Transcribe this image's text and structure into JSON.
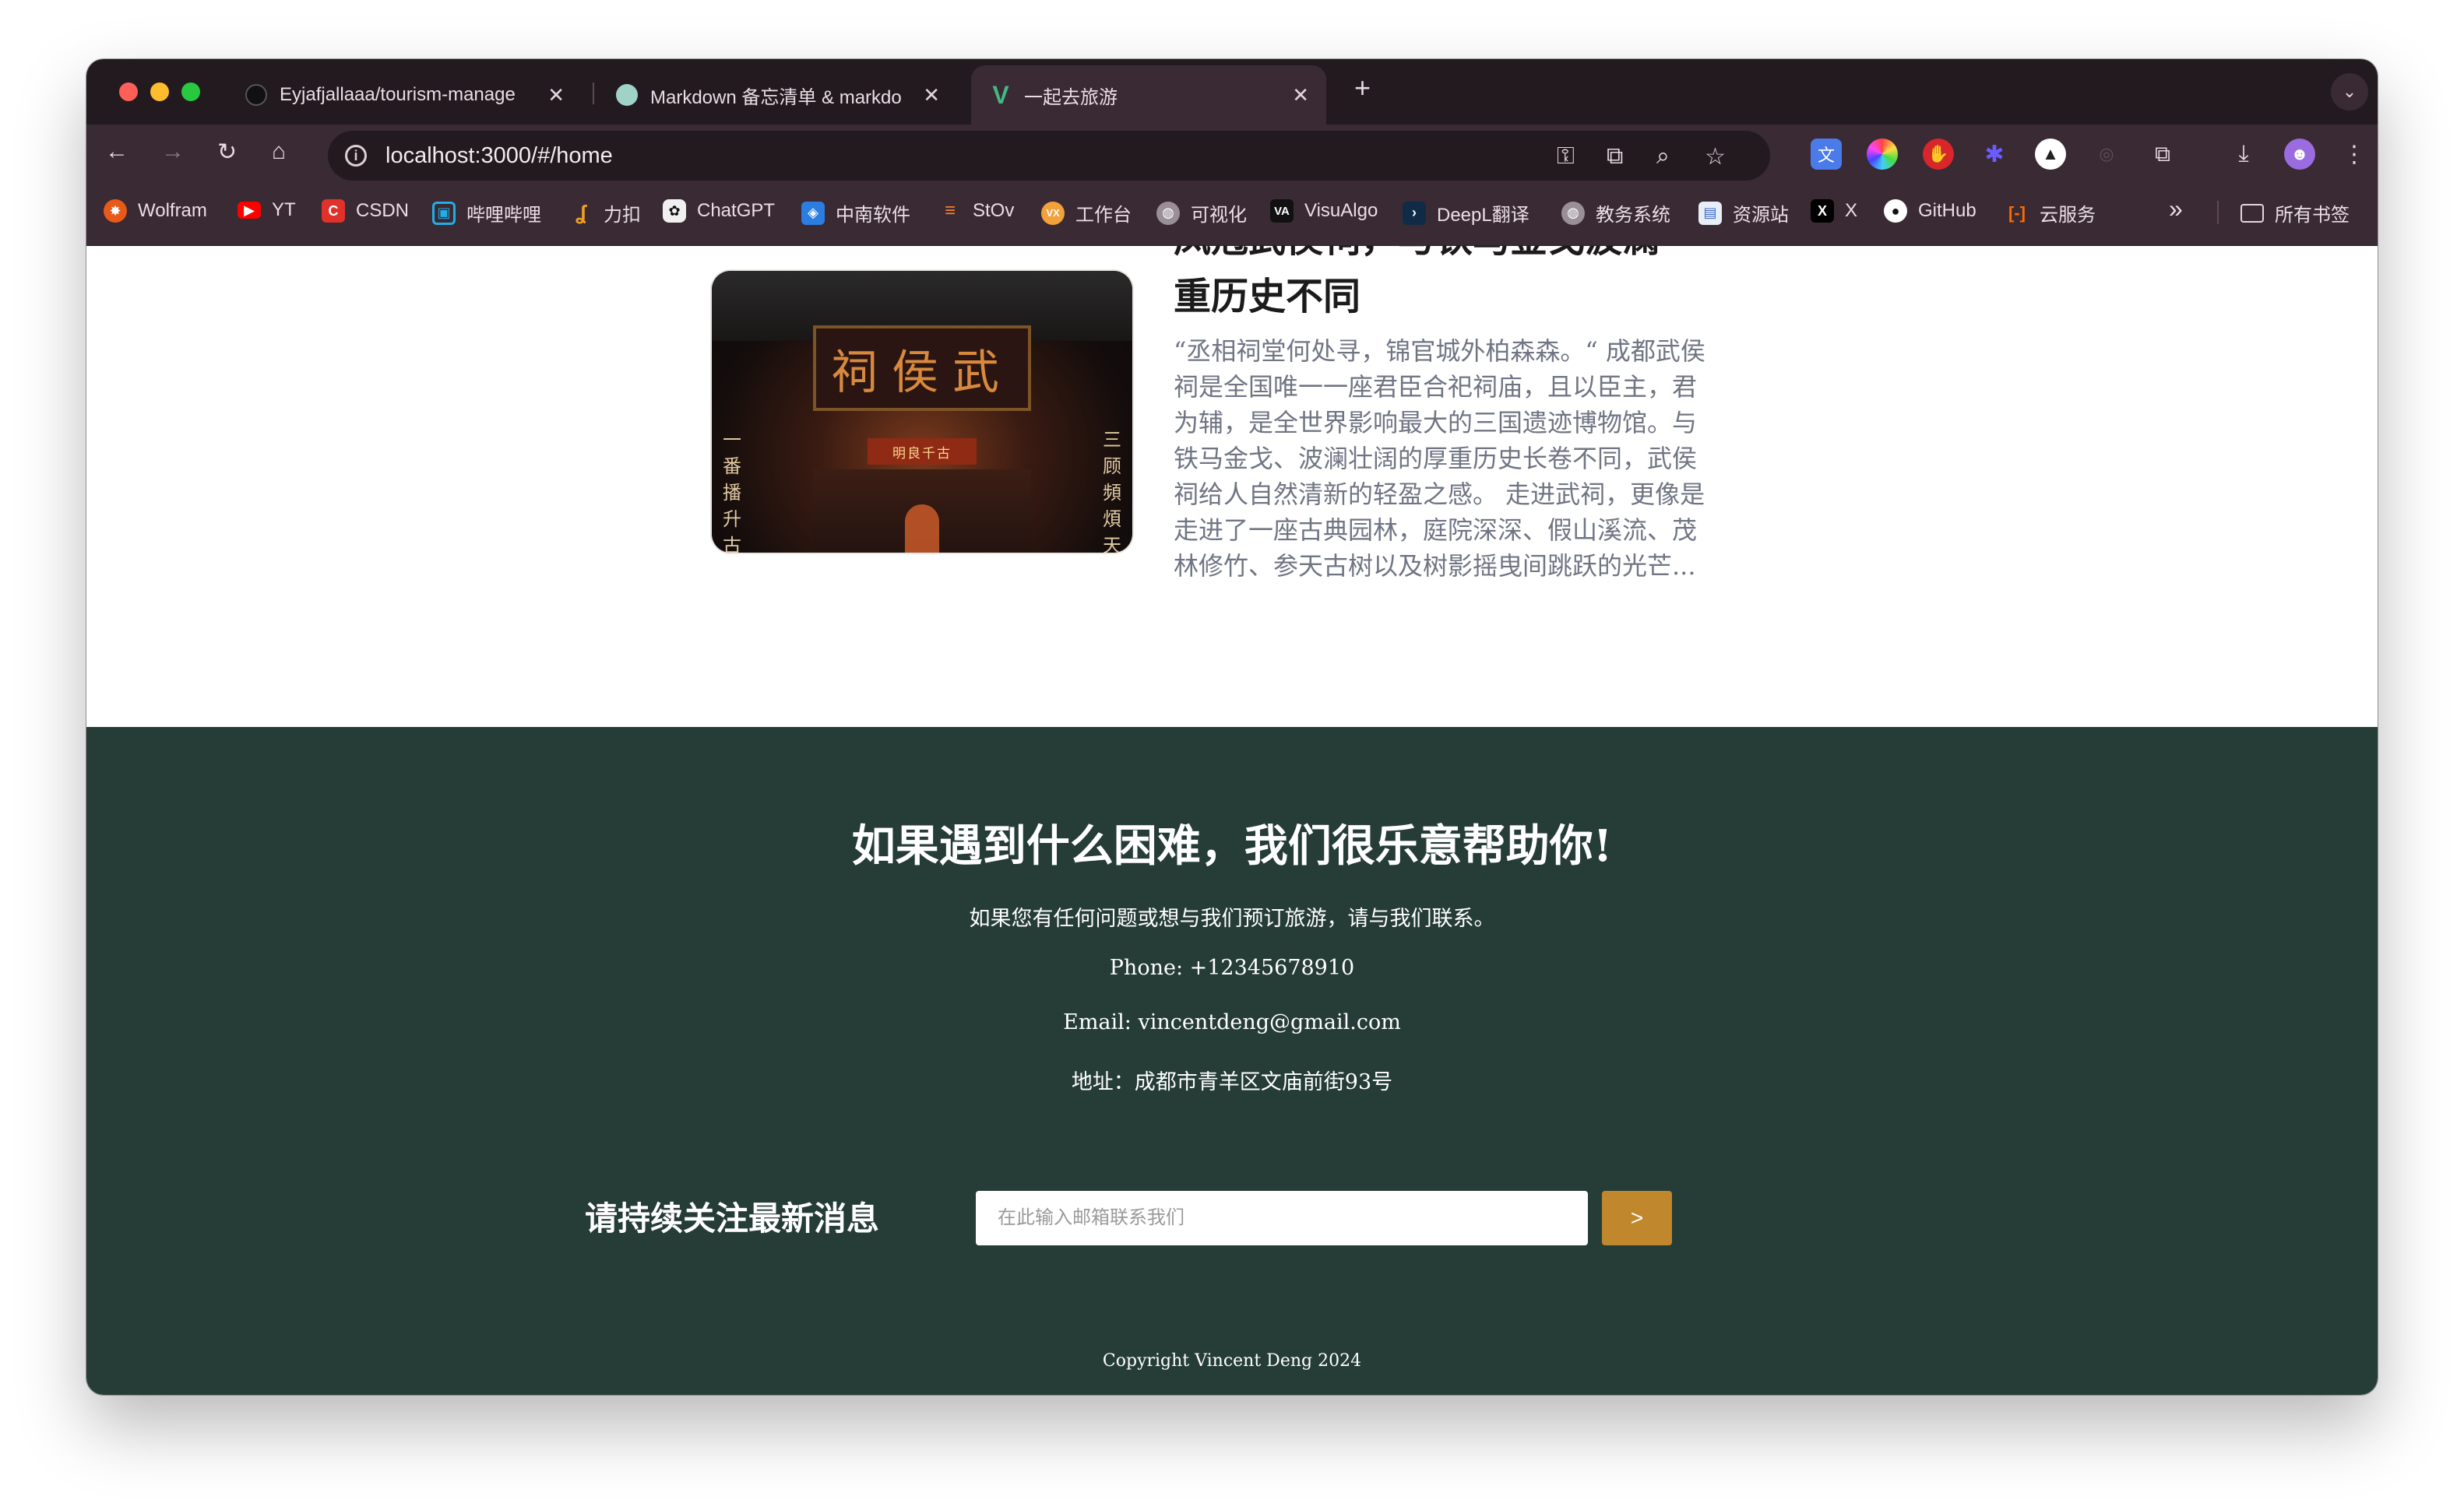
{
  "browser": {
    "tabs": [
      {
        "title": "Eyjafjallaaa/tourism-manage",
        "close": "✕",
        "active": false
      },
      {
        "title": "Markdown 备忘清单 & markdo",
        "close": "✕",
        "active": false
      },
      {
        "title": "一起去旅游",
        "close": "✕",
        "active": true
      }
    ],
    "new_tab": "+",
    "tab_menu": "⌄",
    "url": "localhost:3000/#/home",
    "bookmarks": [
      {
        "label": "Wolfram",
        "icon": "wolfram-icon",
        "color": "#e8591a"
      },
      {
        "label": "YT",
        "icon": "youtube-icon",
        "color": "#ff0000"
      },
      {
        "label": "CSDN",
        "icon": "csdn-icon",
        "color": "#e0312a"
      },
      {
        "label": "哔哩哔哩",
        "icon": "bilibili-icon",
        "color": "#23ade5"
      },
      {
        "label": "力扣",
        "icon": "leetcode-icon",
        "color": "#f0a020"
      },
      {
        "label": "ChatGPT",
        "icon": "chatgpt-icon",
        "color": "#10a37f"
      },
      {
        "label": "中南软件",
        "icon": "school-icon",
        "color": "#2b7de0"
      },
      {
        "label": "StOv",
        "icon": "stackoverflow-icon",
        "color": "#f48024"
      },
      {
        "label": "工作台",
        "icon": "workbench-icon",
        "color": "#f2a13b"
      },
      {
        "label": "可视化",
        "icon": "globe-icon",
        "color": "#9a8f96"
      },
      {
        "label": "VisuAlgo",
        "icon": "visualgo-icon",
        "color": "#111111"
      },
      {
        "label": "DeepL翻译",
        "icon": "deepl-icon",
        "color": "#0f2b46"
      },
      {
        "label": "教务系统",
        "icon": "globe-icon",
        "color": "#9a8f96"
      },
      {
        "label": "资源站",
        "icon": "resource-icon",
        "color": "#6b8fd4"
      },
      {
        "label": "X",
        "icon": "x-icon",
        "color": "#000000"
      },
      {
        "label": "GitHub",
        "icon": "github-icon",
        "color": "#ffffff"
      },
      {
        "label": "云服务",
        "icon": "cloud-service-icon",
        "color": "#ff6a00"
      }
    ],
    "more_bookmarks": "»",
    "all_bookmarks": "所有书签"
  },
  "article": {
    "title_line_1": "凤冠武侯祠，与铁马金戈波澜",
    "title_line_2": "重历史不同",
    "body": "“丞相祠堂何处寻，锦官城外柏森森。“ 成都武侯祠是全国唯一一座君臣合祀祠庙，且以臣主，君为辅，是全世界影响最大的三国遗迹博物馆。与铁马金戈、波澜壮阔的厚重历史长卷不同，武侯祠给人自然清新的轻盈之感。 走进武祠，更像是走进了一座古典园林，庭院深深、假山溪流、茂林修竹、参天古树以及树影摇曳间跳跃的光芒...",
    "image": {
      "board_text": "祠侯武",
      "sub_text": "明良千古",
      "couplet_left": "一番播升古",
      "couplet_right": "三顾頻煩天"
    }
  },
  "footer": {
    "title": "如果遇到什么困难，我们很乐意帮助你!",
    "intro": "如果您有任何问题或想与我们预订旅游，请与我们联系。",
    "phone": "Phone: +12345678910",
    "email": "Email: vincentdeng@gmail.com",
    "address": "地址：成都市青羊区文庙前街93号",
    "subscribe_label": "请持续关注最新消息",
    "subscribe_placeholder": "在此输入邮箱联系我们",
    "subscribe_button": ">",
    "copyright": "Copyright Vincent Deng 2024"
  },
  "colors": {
    "footer_bg": "#253c37",
    "accent_button": "#c0872d",
    "tab_bar": "#231a20",
    "toolbar": "#3a2a33"
  }
}
